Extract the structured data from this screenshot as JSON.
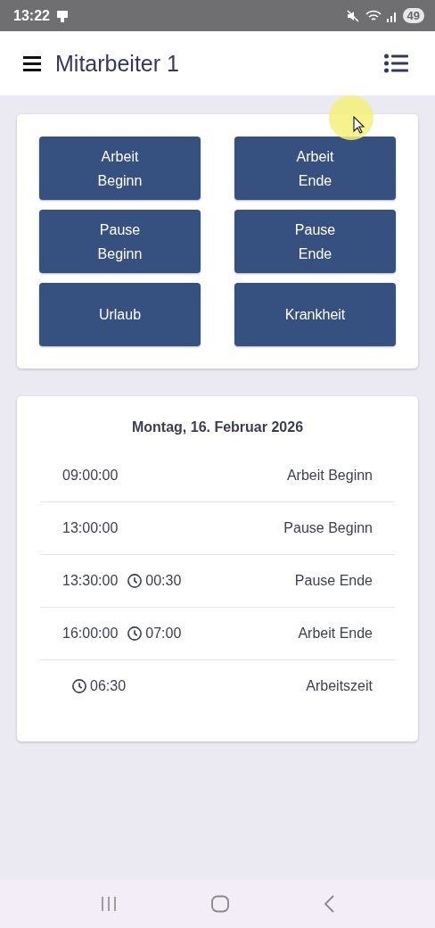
{
  "status_bar": {
    "time": "13:22",
    "battery": "49"
  },
  "app_bar": {
    "title": "Mitarbeiter 1"
  },
  "actions": [
    {
      "label": "Arbeit\nBeginn"
    },
    {
      "label": "Arbeit\nEnde"
    },
    {
      "label": "Pause\nBeginn"
    },
    {
      "label": "Pause\nEnde"
    },
    {
      "label": "Urlaub"
    },
    {
      "label": "Krankheit"
    }
  ],
  "day": {
    "date": "Montag, 16. Februar 2026",
    "entries": [
      {
        "time": "09:00:00",
        "label": "Arbeit Beginn"
      },
      {
        "time": "13:00:00",
        "label": "Pause Beginn"
      },
      {
        "time": "13:30:00",
        "duration": "00:30",
        "label": "Pause Ende"
      },
      {
        "time": "16:00:00",
        "duration": "07:00",
        "label": "Arbeit Ende"
      },
      {
        "duration": "06:30",
        "label": "Arbeitszeit"
      }
    ]
  }
}
